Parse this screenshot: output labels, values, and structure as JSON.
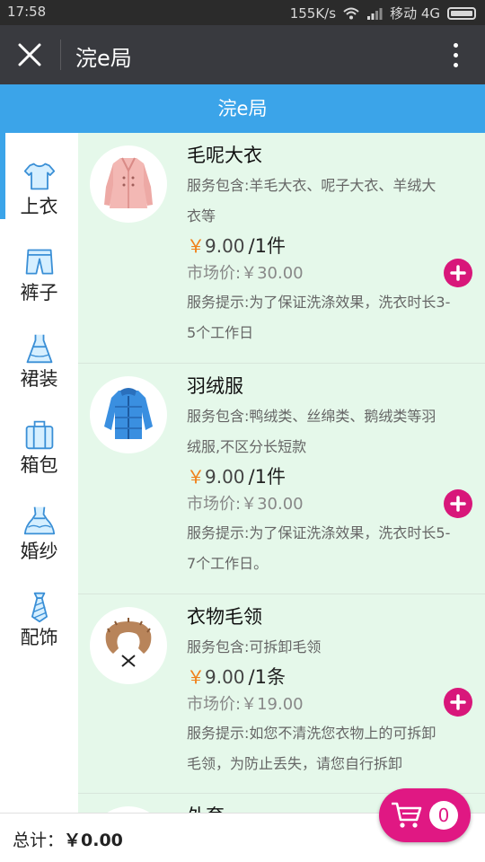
{
  "status": {
    "time": "17:58",
    "speed": "155K/s",
    "carrier": "移动 4G"
  },
  "nav": {
    "title": "浣e局"
  },
  "header": {
    "title": "浣e局"
  },
  "sidebar": {
    "items": [
      {
        "label": "上衣",
        "icon": "shirt-icon"
      },
      {
        "label": "裤子",
        "icon": "pants-icon"
      },
      {
        "label": "裙装",
        "icon": "dress-icon"
      },
      {
        "label": "箱包",
        "icon": "bag-icon"
      },
      {
        "label": "婚纱",
        "icon": "wedding-dress-icon"
      },
      {
        "label": "配饰",
        "icon": "tie-icon"
      }
    ],
    "active_index": 0
  },
  "products": [
    {
      "name": "毛呢大衣",
      "desc1": "服务包含:羊毛大衣、呢子大衣、羊绒大",
      "desc2": "衣等",
      "yen": "￥",
      "price": "9.00",
      "unit": "/1件",
      "market": "市场价:￥30.00",
      "tip1": "服务提示:为了保证洗涤效果，洗衣时长3-",
      "tip2": "5个工作日"
    },
    {
      "name": "羽绒服",
      "desc1": "服务包含:鸭绒类、丝绵类、鹅绒类等羽",
      "desc2": "绒服,不区分长短款",
      "yen": "￥",
      "price": "9.00",
      "unit": "/1件",
      "market": "市场价:￥30.00",
      "tip1": "服务提示:为了保证洗涤效果，洗衣时长5-",
      "tip2": "7个工作日。"
    },
    {
      "name": "衣物毛领",
      "desc1": "服务包含:可拆卸毛领",
      "yen": "￥",
      "price": "9.00",
      "unit": "/1条",
      "market": "市场价:￥19.00",
      "tip1": "服务提示:如您不清洗您衣物上的可拆卸",
      "tip2": "毛领，为防止丢失，请您自行拆卸"
    },
    {
      "name": "外套"
    }
  ],
  "footer": {
    "total_label": "总计：",
    "total_value": "￥0.00"
  },
  "cart": {
    "count": "0"
  },
  "colors": {
    "accent": "#3ba4e9",
    "add": "#d8177a",
    "cart": "#e01883",
    "content_bg": "#e5f8ea"
  }
}
